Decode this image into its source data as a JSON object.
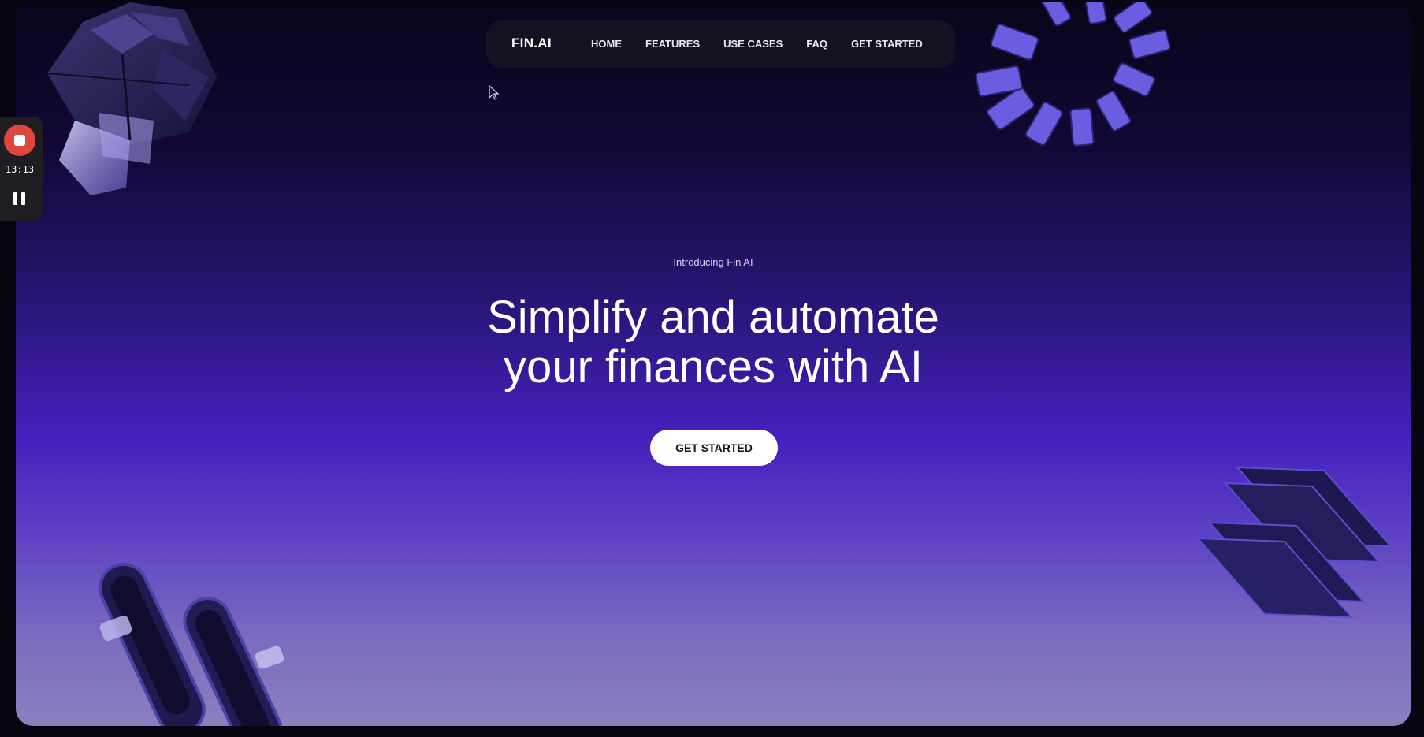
{
  "nav": {
    "logo": "FIN.AI",
    "links": [
      "HOME",
      "FEATURES",
      "USE CASES",
      "FAQ",
      "GET STARTED"
    ]
  },
  "hero": {
    "eyebrow": "Introducing Fin AI",
    "headline_line1": "Simplify and automate",
    "headline_line2": "your finances with AI",
    "cta_label": "GET STARTED"
  },
  "recorder": {
    "time": "13:13",
    "stop_icon": "stop-record-icon",
    "pause_icon": "pause-icon"
  },
  "colors": {
    "accent": "#4420bd",
    "background_top": "#07051a",
    "background_bottom": "#8b80bf",
    "record_red": "#e0473c"
  }
}
